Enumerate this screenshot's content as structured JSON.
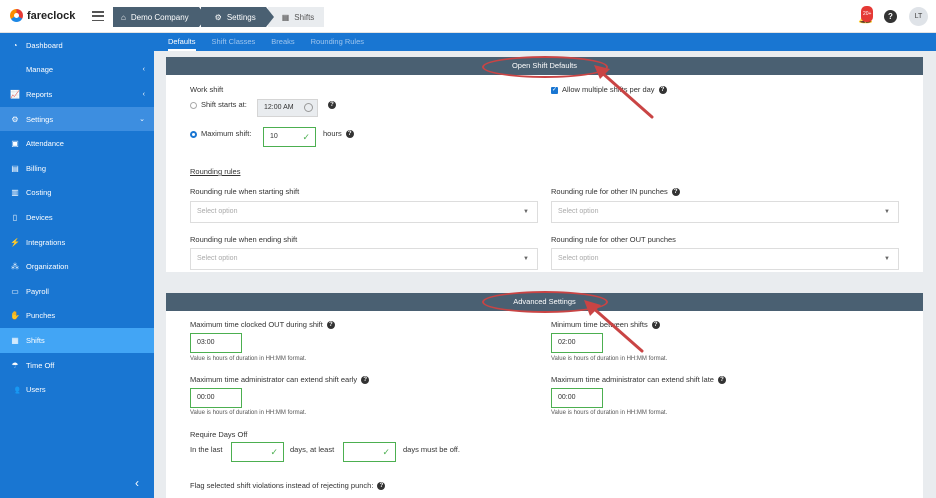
{
  "app": {
    "name": "fareclock"
  },
  "breadcrumb": [
    {
      "label": "Demo Company",
      "icon": "home-icon"
    },
    {
      "label": "Settings",
      "icon": "gear-icon"
    },
    {
      "label": "Shifts",
      "icon": "calendar-icon"
    }
  ],
  "topbar": {
    "notification_count": "20+",
    "help": "?",
    "user_initials": "LT"
  },
  "sidebar": {
    "items": [
      {
        "label": "Dashboard",
        "icon": "dashboard-icon"
      },
      {
        "label": "Manage",
        "icon": "person-icon",
        "chevron": "‹"
      },
      {
        "label": "Reports",
        "icon": "chart-icon",
        "chevron": "‹"
      },
      {
        "label": "Settings",
        "icon": "gear-icon",
        "chevron": "⌄"
      },
      {
        "label": "Attendance",
        "icon": "attendance-icon"
      },
      {
        "label": "Billing",
        "icon": "billing-icon"
      },
      {
        "label": "Costing",
        "icon": "costing-icon"
      },
      {
        "label": "Devices",
        "icon": "device-icon"
      },
      {
        "label": "Integrations",
        "icon": "plug-icon"
      },
      {
        "label": "Organization",
        "icon": "org-icon"
      },
      {
        "label": "Payroll",
        "icon": "payroll-icon"
      },
      {
        "label": "Punches",
        "icon": "punch-icon"
      },
      {
        "label": "Shifts",
        "icon": "shifts-icon"
      },
      {
        "label": "Time Off",
        "icon": "umbrella-icon"
      },
      {
        "label": "Users",
        "icon": "users-icon"
      }
    ],
    "collapse": "‹"
  },
  "tabs": [
    "Defaults",
    "Shift Classes",
    "Breaks",
    "Rounding Rules"
  ],
  "open_shift": {
    "header": "Open Shift Defaults",
    "work_shift": "Work shift",
    "starts_at_label": "Shift starts at:",
    "starts_at_value": "12:00 AM",
    "max_shift_label": "Maximum shift:",
    "max_shift_value": "10",
    "hours": "hours",
    "allow_multiple": "Allow multiple shifts per day",
    "rounding_rules": "Rounding rules",
    "round_start_label": "Rounding rule when starting shift",
    "round_in_label": "Rounding rule for other IN punches",
    "round_end_label": "Rounding rule when ending shift",
    "round_out_label": "Rounding rule for other OUT punches",
    "select_placeholder": "Select option"
  },
  "advanced": {
    "header": "Advanced Settings",
    "max_out_label": "Maximum time clocked OUT during shift",
    "max_out_value": "03:00",
    "min_between_label": "Minimum time between shifts",
    "min_between_value": "02:00",
    "hint": "Value is hours of duration in HH:MM format.",
    "extend_early_label": "Maximum time administrator can extend shift early",
    "extend_early_value": "00:00",
    "extend_late_label": "Maximum time administrator can extend shift late",
    "extend_late_value": "00:00",
    "require_days_off": "Require Days Off",
    "in_the_last": "In the last",
    "days_at_least": "days, at least",
    "days_must_be_off": "days must be off.",
    "flag_label": "Flag selected shift violations instead of rejecting punch:"
  },
  "colors": {
    "sidebar": "#1976d2",
    "panel_header": "#4a6072",
    "annotation": "#c94444",
    "valid": "#4caf50"
  }
}
